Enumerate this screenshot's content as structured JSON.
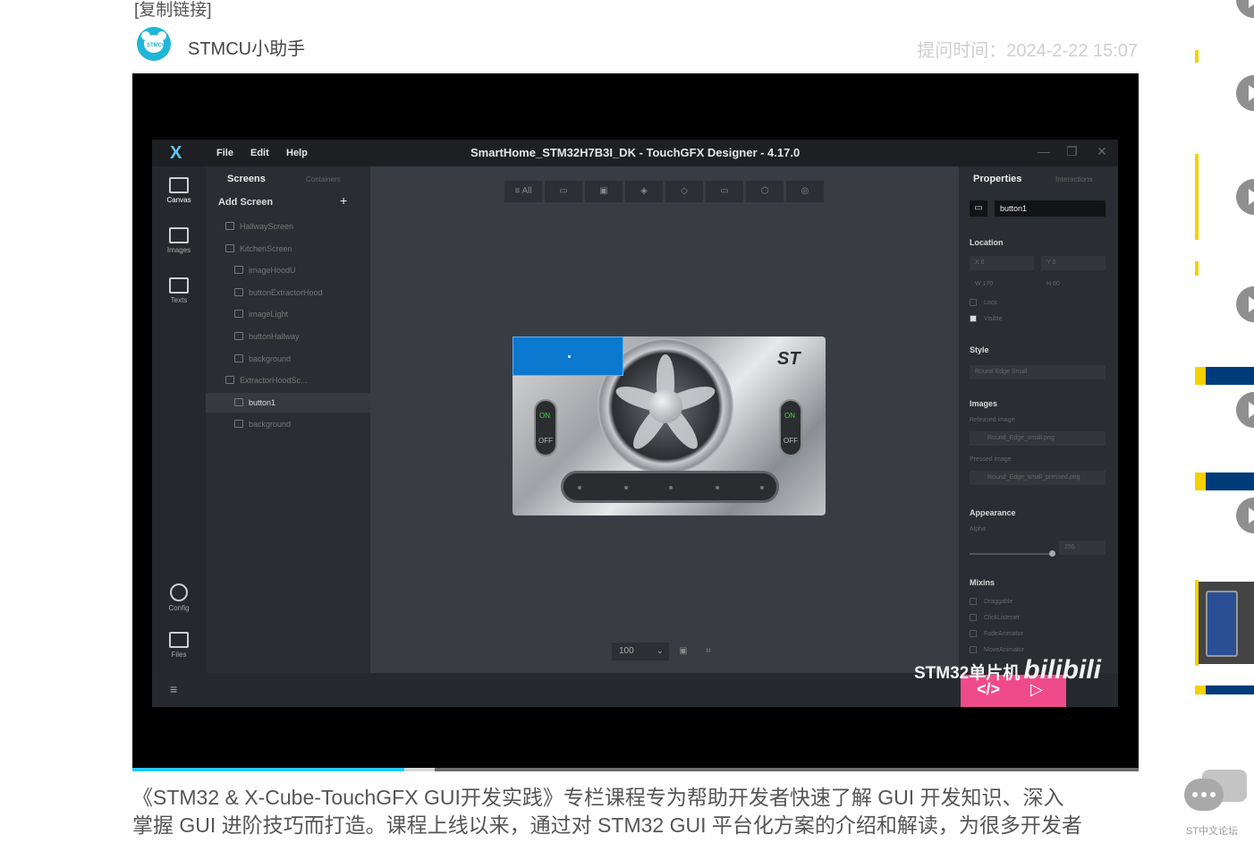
{
  "post": {
    "copy_link": "[复制链接]",
    "author": "STMCU小助手",
    "avatar_text": "STMCU",
    "time": "提问时间：2024-2-22 15:07",
    "caption_line1": "《STM32 & X-Cube-TouchGFX GUI开发实践》专栏课程专为帮助开发者快速了解 GUI 开发知识、深入",
    "caption_line2": "掌握 GUI 进阶技巧而打造。课程上线以来，通过对 STM32 GUI 平台化方案的介绍和解读，为很多开发者"
  },
  "video": {
    "progress": 0.27,
    "buffered": 0.3
  },
  "app": {
    "logo": "X",
    "menu": [
      "File",
      "Edit",
      "Help"
    ],
    "title": "SmartHome_STM32H7B3I_DK - TouchGFX Designer - 4.17.0",
    "window_buttons": [
      "—",
      "❐",
      "✕"
    ],
    "nav": [
      {
        "label": "Canvas",
        "icon": "canvas-icon"
      },
      {
        "label": "Images",
        "icon": "images-icon"
      },
      {
        "label": "Texts",
        "icon": "texts-icon"
      },
      {
        "label": "Config",
        "icon": "gear-icon"
      },
      {
        "label": "Files",
        "icon": "folder-icon"
      }
    ],
    "tree": {
      "tab_screens": "Screens",
      "tab_containers": "Containers",
      "add_screen": "Add Screen",
      "items": [
        {
          "label": "HallwayScreen",
          "indent": 0
        },
        {
          "label": "KitchenScreen",
          "indent": 0
        },
        {
          "label": "imageHoodU",
          "indent": 1
        },
        {
          "label": "buttonExtractorHood",
          "indent": 1
        },
        {
          "label": "imageLight",
          "indent": 1
        },
        {
          "label": "buttonHallway",
          "indent": 1
        },
        {
          "label": "background",
          "indent": 1
        },
        {
          "label": "ExtractorHoodSc...",
          "indent": 0
        },
        {
          "label": "button1",
          "indent": 1
        },
        {
          "label": "background",
          "indent": 1
        }
      ]
    },
    "toolbar": [
      "≡ All",
      "▭",
      "▣",
      "◈",
      "◇",
      "▭",
      "⬡",
      "◎"
    ],
    "zoom": "100",
    "device": {
      "switch_on": "ON",
      "switch_off": "OFF",
      "brand": "ST"
    },
    "properties": {
      "tab_properties": "Properties",
      "tab_interactions": "Interactions",
      "name": "button1",
      "location": "Location",
      "x": "X  0",
      "y": "Y  0",
      "w": "W  170",
      "h": "H  60",
      "lock": "Lock",
      "visible": "Visible",
      "style": "Style",
      "style_value": "Round Edge Small",
      "images": "Images",
      "released_label": "Released image",
      "released_value": "Round_Edge_small.png",
      "pressed_label": "Pressed image",
      "pressed_value": "Round_Edge_small_pressed.png",
      "appearance": "Appearance",
      "alpha_label": "Alpha",
      "alpha_value": "255",
      "mixins": "Mixins",
      "mixin_items": [
        "Draggable",
        "ClickListener",
        "FadeAnimator",
        "MoveAnimator"
      ]
    }
  },
  "watermark": {
    "channel": "STM32单片机",
    "brand": "bilibili"
  },
  "sidebar": {
    "forum_label": "ST中文论坛"
  }
}
